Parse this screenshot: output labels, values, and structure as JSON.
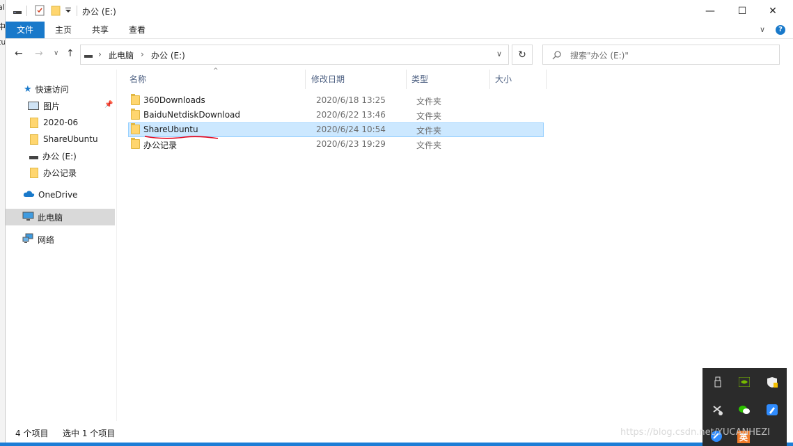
{
  "title": {
    "window_title": "办公 (E:)",
    "minimize": "—",
    "maximize": "☐",
    "close": "✕"
  },
  "desktop_strip": [
    "al",
    "中",
    "tu"
  ],
  "ribbon": {
    "tabs": [
      "文件",
      "主页",
      "共享",
      "查看"
    ],
    "expand": "∨",
    "help": "?"
  },
  "address": {
    "back": "←",
    "forward": "→",
    "recent": "∨",
    "up": "↑",
    "crumbs": [
      "此电脑",
      "办公 (E:)"
    ],
    "separator": "›",
    "dropdown": "∨",
    "refresh": "↻",
    "search_placeholder": "搜索\"办公 (E:)\""
  },
  "nav": {
    "items": [
      {
        "label": "快速访问",
        "icon": "star-icon"
      },
      {
        "label": "图片",
        "icon": "pictures-icon",
        "pinned": true
      },
      {
        "label": "2020-06",
        "icon": "folder-icon"
      },
      {
        "label": "ShareUbuntu",
        "icon": "folder-icon"
      },
      {
        "label": "办公 (E:)",
        "icon": "drive-icon"
      },
      {
        "label": "办公记录",
        "icon": "folder-icon"
      },
      {
        "label": "OneDrive",
        "icon": "cloud-icon"
      },
      {
        "label": "此电脑",
        "icon": "computer-icon",
        "selected": true
      },
      {
        "label": "网络",
        "icon": "network-icon"
      }
    ]
  },
  "columns": [
    "名称",
    "修改日期",
    "类型",
    "大小"
  ],
  "files": [
    {
      "name": "360Downloads",
      "date": "2020/6/18 13:25",
      "type": "文件夹"
    },
    {
      "name": "BaiduNetdiskDownload",
      "date": "2020/6/22 13:46",
      "type": "文件夹"
    },
    {
      "name": "ShareUbuntu",
      "date": "2020/6/24 10:54",
      "type": "文件夹",
      "selected": true
    },
    {
      "name": "办公记录",
      "date": "2020/6/23 19:29",
      "type": "文件夹"
    }
  ],
  "status": {
    "count": "4 个项目",
    "selected": "选中 1 个项目"
  },
  "tray": {
    "ime": "英"
  },
  "watermark": "https://blog.csdn.net/YUCANHEZI",
  "colors": {
    "accent": "#1979ca",
    "selection": "#cce8ff",
    "annotation": "#e0001a"
  }
}
